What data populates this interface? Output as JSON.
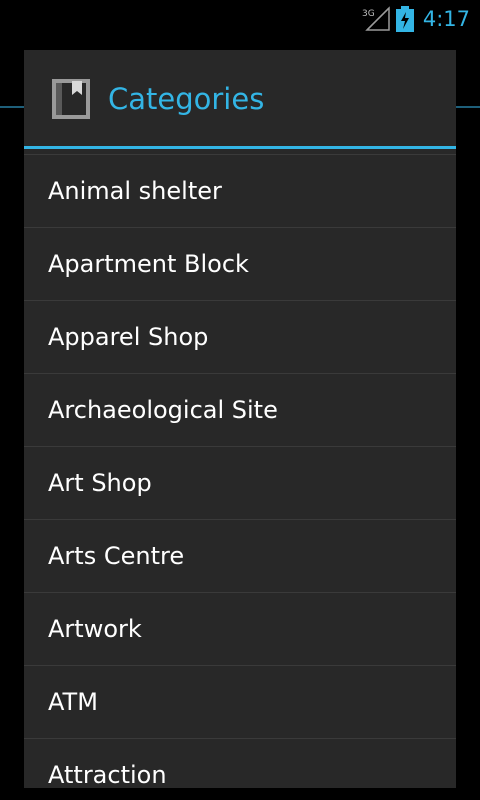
{
  "status_bar": {
    "network_label": "3G",
    "network_icon": "signal-icon",
    "battery_icon": "battery-charging-icon",
    "time": "4:17",
    "accent_color": "#33b5e5"
  },
  "dialog": {
    "icon": "bookmark-icon",
    "title": "Categories",
    "title_color": "#33b5e5",
    "items": [
      {
        "label": "Animal shelter"
      },
      {
        "label": "Apartment Block"
      },
      {
        "label": "Apparel Shop"
      },
      {
        "label": "Archaeological Site"
      },
      {
        "label": "Art Shop"
      },
      {
        "label": "Arts Centre"
      },
      {
        "label": "Artwork"
      },
      {
        "label": "ATM"
      },
      {
        "label": "Attraction"
      }
    ]
  }
}
